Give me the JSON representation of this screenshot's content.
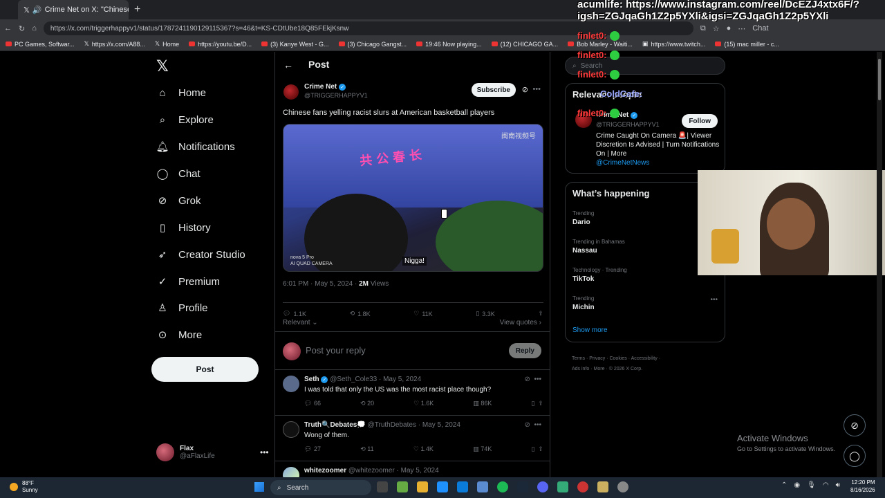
{
  "browser": {
    "tab_title": "Crime Net on X: \"Chinese fans",
    "url": "https://x.com/triggerhappyv1/status/1787241190129115367?s=46&t=KS-CDtUbe18Q85FEkjKsnw",
    "chat_label": "Chat",
    "bookmarks": [
      "PC Games, Softwar...",
      "https://x.com/A88...",
      "Home",
      "https://youtu.be/D...",
      "(3) Kanye West - G...",
      "(3) Chicago Gangst...",
      "19:46 Now playing...",
      "(12) CHICAGO GA...",
      "Bob Marley - Waiti...",
      "https://www.twitch...",
      "(15) mac miller - c..."
    ]
  },
  "nav": {
    "items": [
      {
        "label": "Home",
        "icon": "home-icon"
      },
      {
        "label": "Explore",
        "icon": "search-icon"
      },
      {
        "label": "Notifications",
        "icon": "bell-icon"
      },
      {
        "label": "Chat",
        "icon": "chat-icon"
      },
      {
        "label": "Grok",
        "icon": "grok-icon"
      },
      {
        "label": "History",
        "icon": "bookmark-icon"
      },
      {
        "label": "Creator Studio",
        "icon": "rocket-icon"
      },
      {
        "label": "Premium",
        "icon": "verified-icon"
      },
      {
        "label": "Profile",
        "icon": "person-icon"
      },
      {
        "label": "More",
        "icon": "more-circle-icon"
      }
    ],
    "post_button": "Post",
    "profile": {
      "name": "Flax",
      "handle": "@aFlaxLife"
    }
  },
  "main": {
    "title": "Post",
    "author": {
      "name": "Crime Net",
      "handle": "@TRIGGERHAPPYV1"
    },
    "subscribe": "Subscribe",
    "text": "Chinese fans yelling racist slurs at American basketball players",
    "media": {
      "watermark": "闽南视频号",
      "bus_text": "共公春长",
      "camera": "nova 5 Pro\nAI QUAD CAMERA",
      "subtitle": "Nigga!"
    },
    "timestamp": "6:01 PM · May 5, 2024 · ",
    "views": "2M",
    "views_label": " Views",
    "stats": {
      "replies": "1.1K",
      "reposts": "1.8K",
      "likes": "11K",
      "bookmarks": "3.3K"
    },
    "relevant": "Relevant",
    "view_quotes": "View quotes",
    "reply_placeholder": "Post your reply",
    "reply_button": "Reply",
    "replies": [
      {
        "name": "Seth",
        "handle": "@Seth_Cole33 · May 5, 2024",
        "text": "I was told that only the US was the most racist place though?",
        "replies": "66",
        "reposts": "20",
        "likes": "1.6K",
        "views": "86K"
      },
      {
        "name": "Truth🔍Debates💭",
        "handle": "@TruthDebates · May 5, 2024",
        "text": "Wong of them.",
        "replies": "27",
        "reposts": "11",
        "likes": "1.4K",
        "views": "74K"
      },
      {
        "name": "whitezoomer",
        "handle": "@whitezoomer · May 5, 2024",
        "text": "",
        "replies": "",
        "reposts": "",
        "likes": "",
        "views": ""
      }
    ]
  },
  "right": {
    "search_placeholder": "Search",
    "relevant_title": "Relevant people",
    "person": {
      "name": "Crime Net",
      "handle": "@TRIGGERHAPPYV1",
      "bio": "Crime Caught On Camera 🚨| Viewer Discretion Is Advised | Turn Notifications On | More",
      "link": "@CrimeNetNews"
    },
    "follow": "Follow",
    "happening_title": "What’s happening",
    "trends": [
      {
        "meta": "Trending",
        "name": "Dario"
      },
      {
        "meta": "Trending in Bahamas",
        "name": "Nassau"
      },
      {
        "meta": "Technology · Trending",
        "name": "TikTok"
      },
      {
        "meta": "Trending",
        "name": "Michin"
      }
    ],
    "show_more": "Show more",
    "footer": [
      "Terms",
      "Privacy",
      "Cookies",
      "Accessibility",
      "Ads info",
      "More",
      "© 2026 X Corp."
    ]
  },
  "overlay": {
    "top_line1": "acumlife: https://www.instagram.com/reel/DcEZJ4xtx6F/?",
    "top_line2": "igsh=ZGJqaGh1Z2p5YXli&igsi=ZGJqaGh1Z2p5YXli",
    "chat_lines": [
      "finlet0:",
      "finlet0:",
      "finlet0:",
      "ColdCafe:",
      "finlet0:"
    ]
  },
  "windows": {
    "activate_title": "Activate Windows",
    "activate_sub": "Go to Settings to activate Windows.",
    "temp": "88°F",
    "condition": "Sunny",
    "search": "Search",
    "time": "12:20 PM",
    "date": "8/16/2026"
  }
}
